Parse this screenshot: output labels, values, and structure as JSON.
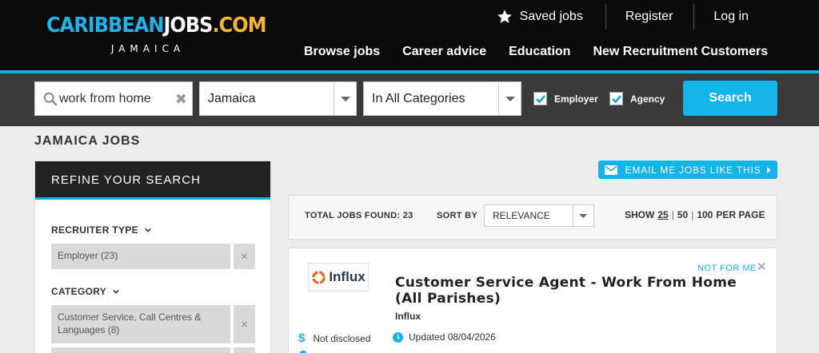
{
  "brand": {
    "logo_part1": "CARIBBEAN",
    "logo_part2": "JOBS",
    "logo_part3": ".COM",
    "subtitle": "JAMAICA"
  },
  "header": {
    "saved_jobs": "Saved jobs",
    "register": "Register",
    "login": "Log in",
    "nav": [
      "Browse jobs",
      "Career advice",
      "Education",
      "New Recruitment Customers"
    ],
    "active_nav": "Browse jobs"
  },
  "search": {
    "keywords_value": "work from home",
    "location_value": "Jamaica",
    "category_value": "In All Categories",
    "employer_label": "Employer",
    "employer_checked": true,
    "agency_label": "Agency",
    "agency_checked": true,
    "button_label": "Search"
  },
  "page_title": "JAMAICA JOBS",
  "sidebar": {
    "heading": "REFINE YOUR SEARCH",
    "facets": [
      {
        "title": "RECRUITER TYPE",
        "items": [
          "Employer (23)"
        ]
      },
      {
        "title": "CATEGORY",
        "items": [
          "Customer Service, Call Centres & Languages (8)"
        ]
      }
    ]
  },
  "email_alert": "EMAIL ME JOBS LIKE THIS",
  "results": {
    "total_label": "TOTAL JOBS FOUND: 23",
    "sort_label": "SORT BY",
    "sort_value": "RELEVANCE",
    "show_label": "SHOW",
    "show_options": [
      "25",
      "50",
      "100"
    ],
    "show_selected": "25",
    "per_page_label": "PER PAGE"
  },
  "job": {
    "company_logo_text": "Influx",
    "not_for_me": "NOT FOR ME",
    "title": "Customer Service Agent - Work From Home (All Parishes)",
    "company": "Influx",
    "salary": "Not disclosed",
    "updated": "Updated 08/04/2026"
  },
  "colors": {
    "accent": "#14b1e7",
    "header_bg": "#0b0b0b",
    "search_bg": "#3a3a3a",
    "logo_orange": "#f7b52b",
    "influx_orange": "#f26a21"
  },
  "icons": {
    "saved": "star-icon",
    "search": "magnifier-icon",
    "clear": "close-icon",
    "email": "envelope-icon",
    "salary": "dollar-icon",
    "updated": "clock-icon"
  }
}
